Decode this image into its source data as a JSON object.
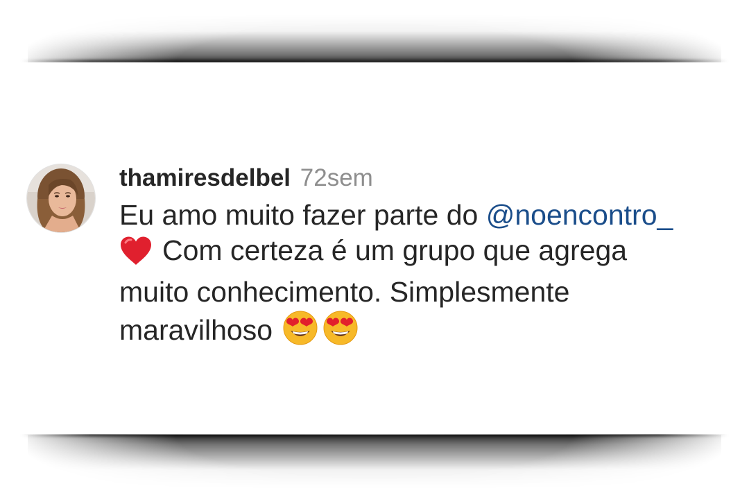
{
  "comment": {
    "username": "thamiresdelbel",
    "time": "72sem",
    "text_before_mention": "Eu amo muito fazer parte do ",
    "mention": "@noencontro_",
    "text_line2": "Com certeza é um grupo que agrega",
    "text_line3": "muito conhecimento. Simplesmente",
    "text_line4": "maravilhoso",
    "emojis": [
      "red-heart",
      "heart-eyes-face",
      "heart-eyes-face"
    ]
  },
  "colors": {
    "text": "#262626",
    "muted": "#8e8e8e",
    "mention": "#1a4d8a",
    "heart": "#e0202e",
    "emoji_face": "#f7b928"
  }
}
